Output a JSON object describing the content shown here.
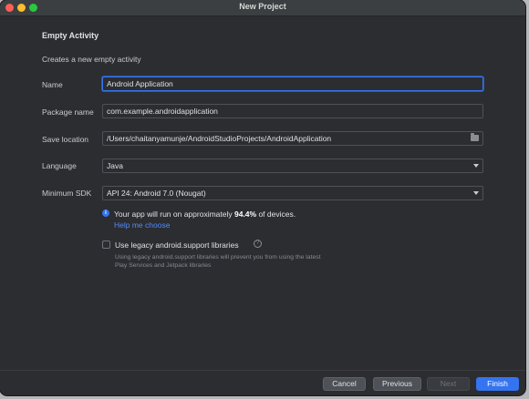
{
  "window": {
    "title": "New Project"
  },
  "form": {
    "heading": "Empty Activity",
    "description": "Creates a new empty activity",
    "name": {
      "label": "Name",
      "value": "Android Application"
    },
    "package": {
      "label": "Package name",
      "value": "com.example.androidapplication"
    },
    "save_location": {
      "label": "Save location",
      "value": "/Users/chaitanyamunje/AndroidStudioProjects/AndroidApplication"
    },
    "language": {
      "label": "Language",
      "value": "Java"
    },
    "min_sdk": {
      "label": "Minimum SDK",
      "value": "API 24: Android 7.0 (Nougat)"
    }
  },
  "info": {
    "prefix": "Your app will run on approximately ",
    "percent": "94.4%",
    "suffix": " of devices.",
    "help_link": "Help me choose"
  },
  "legacy": {
    "label": "Use legacy android.support libraries",
    "note": "Using legacy android.support libraries will prevent you from using the latest Play Services and Jetpack libraries"
  },
  "buttons": {
    "cancel": "Cancel",
    "previous": "Previous",
    "next": "Next",
    "finish": "Finish"
  },
  "icons": {
    "info": "info-icon",
    "help": "question-icon",
    "folder": "folder-icon",
    "dropdown": "chevron-down-icon"
  }
}
